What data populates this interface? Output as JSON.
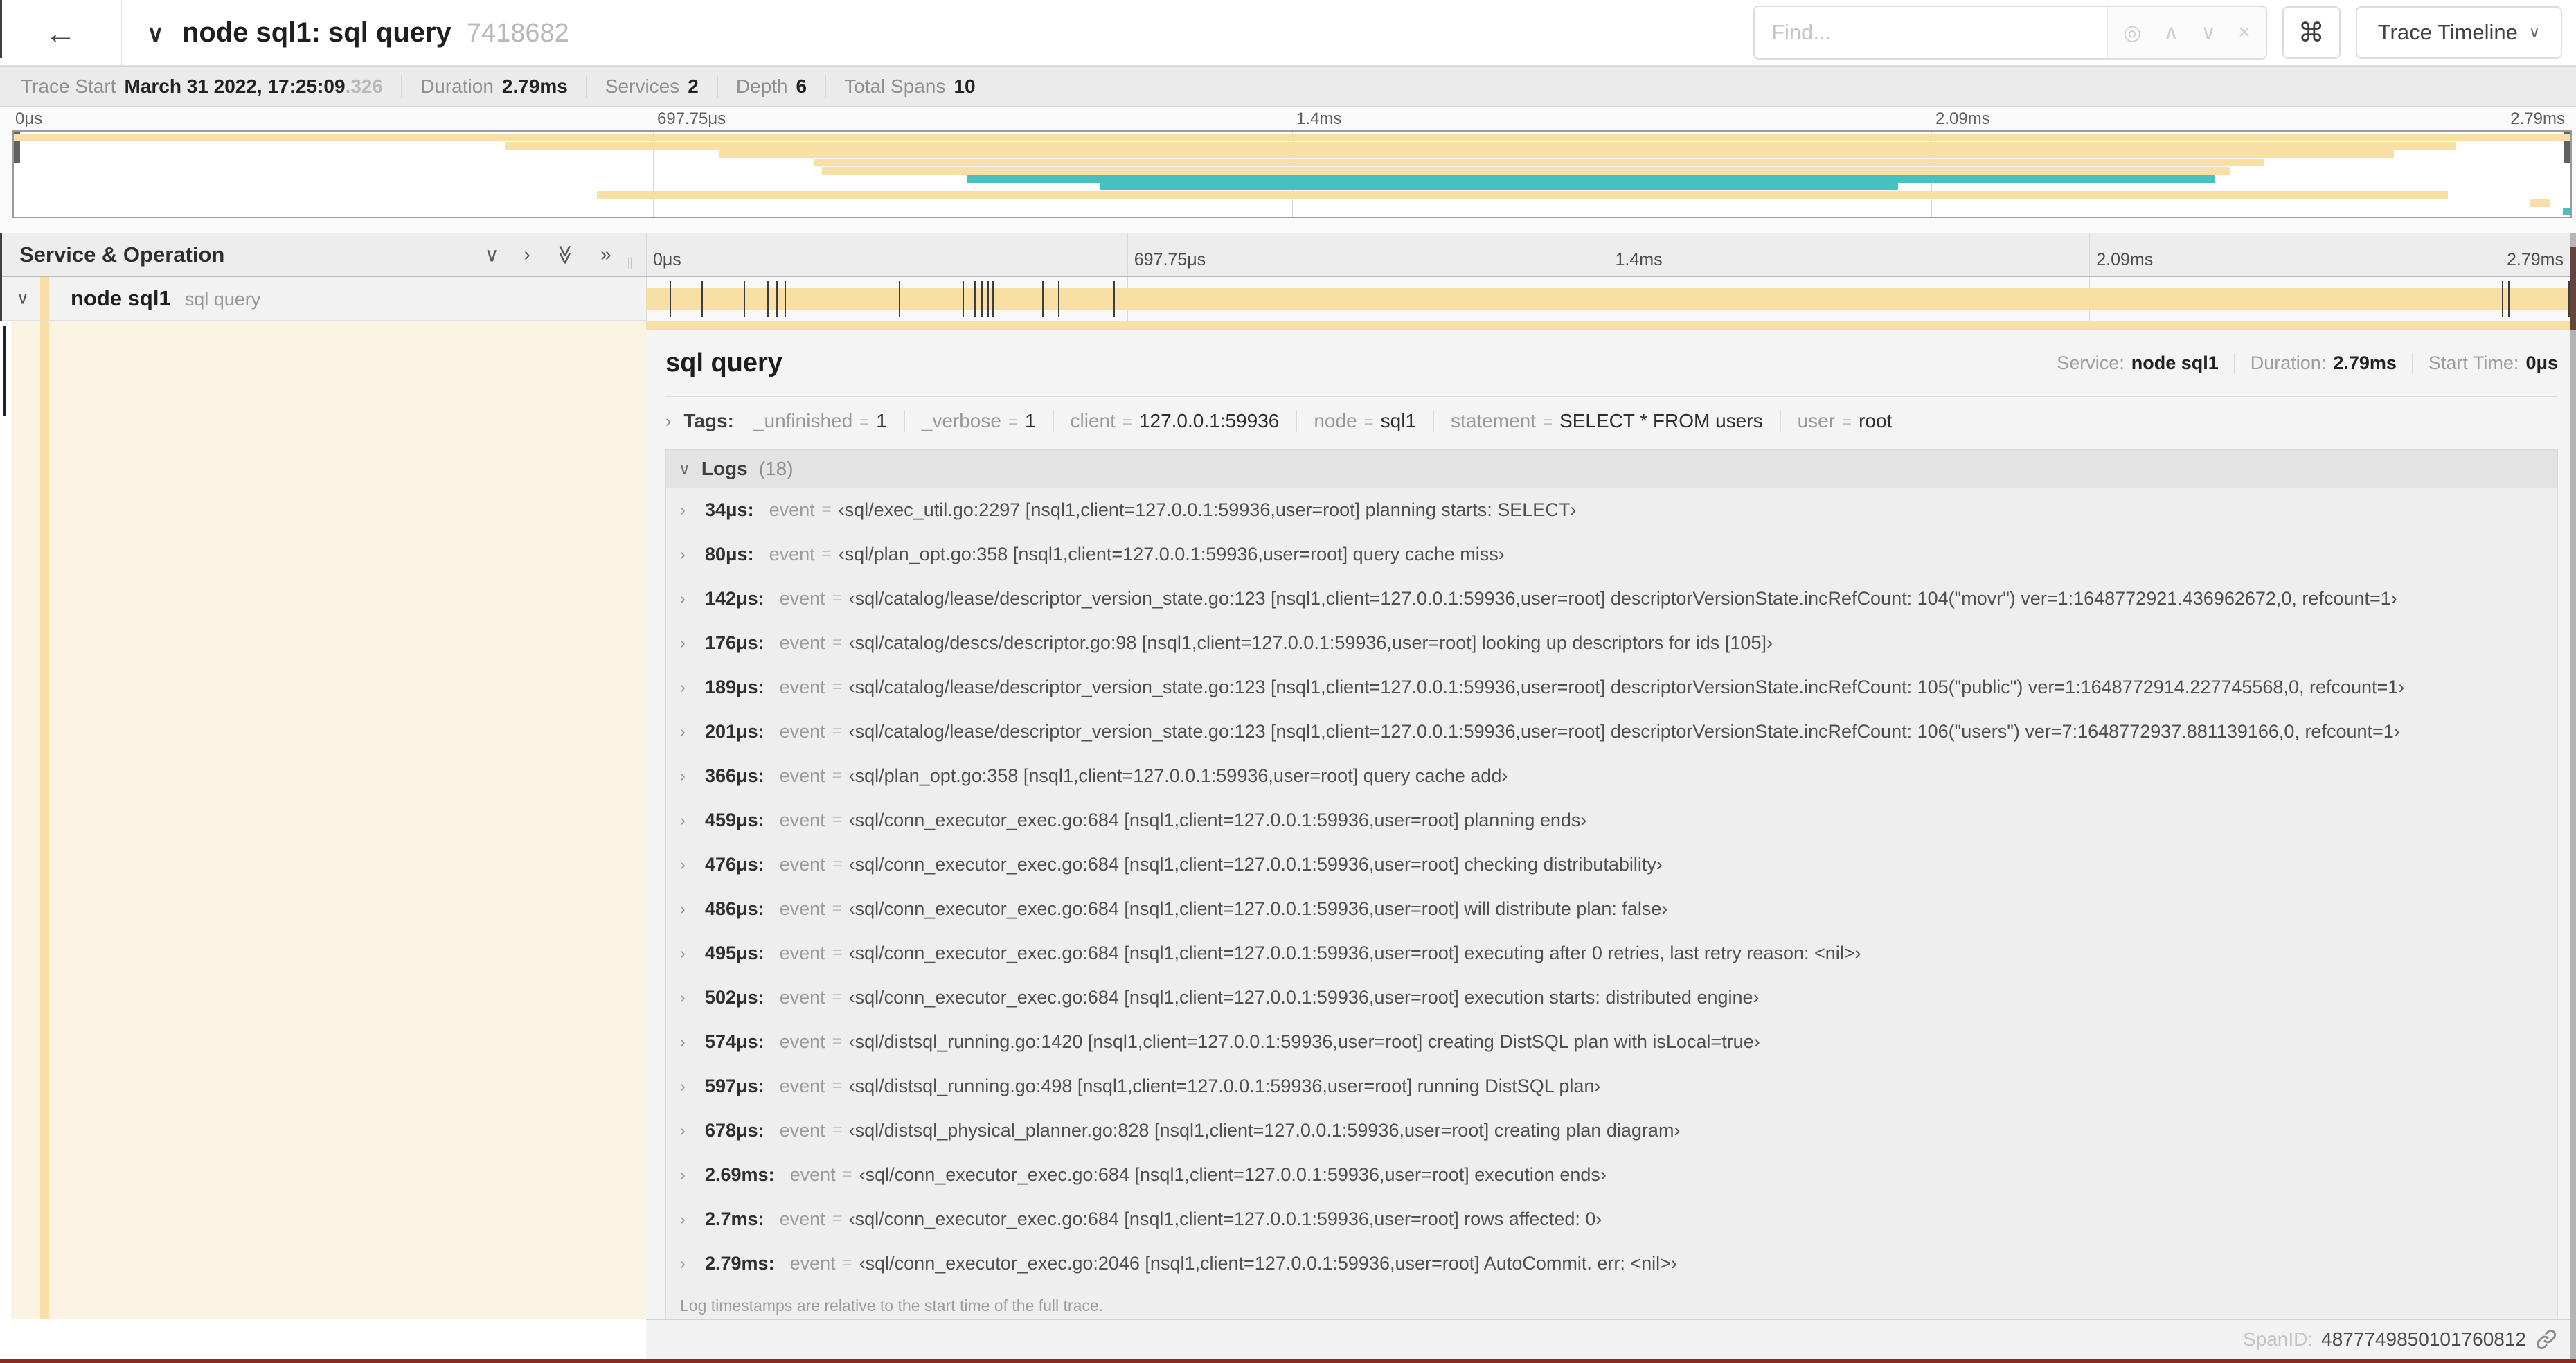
{
  "icons": {
    "back": "←",
    "chevron_down": "∨",
    "chevron_up": "∧",
    "chevron_right": "›",
    "double_down": "≫",
    "double_right": "»",
    "locate": "◎",
    "close": "×",
    "command": "⌘",
    "caret_down": "∨",
    "resizer": "‖"
  },
  "colors": {
    "span_tan": "#f7dfa6",
    "span_teal": "#45c1c1",
    "bottom_accent": "#8a2c21"
  },
  "topbar": {
    "title": "node sql1: sql query",
    "trace_id": "7418682",
    "find": {
      "placeholder": "Find..."
    },
    "view_button": {
      "label": "Trace Timeline"
    }
  },
  "trace_meta": {
    "items": [
      {
        "label": "Trace Start",
        "value": "March 31 2022, 17:25:09",
        "suffix": ".326"
      },
      {
        "label": "Duration",
        "value": "2.79ms"
      },
      {
        "label": "Services",
        "value": "2"
      },
      {
        "label": "Depth",
        "value": "6"
      },
      {
        "label": "Total Spans",
        "value": "10"
      }
    ]
  },
  "minimap": {
    "labels": [
      {
        "text": "0μs",
        "pos": 0
      },
      {
        "text": "697.75μs",
        "pos": 25
      },
      {
        "text": "1.4ms",
        "pos": 50
      },
      {
        "text": "2.09ms",
        "pos": 75
      },
      {
        "text": "2.79ms",
        "pos": 100
      }
    ],
    "spans": [
      {
        "row": 0,
        "start": 0,
        "end": 100,
        "color": "tan"
      },
      {
        "row": 1,
        "start": 19.2,
        "end": 95.5,
        "color": "tan"
      },
      {
        "row": 2,
        "start": 27.6,
        "end": 93.1,
        "color": "tan"
      },
      {
        "row": 3,
        "start": 31.3,
        "end": 88.0,
        "color": "tan"
      },
      {
        "row": 4,
        "start": 31.6,
        "end": 86.7,
        "color": "tan"
      },
      {
        "row": 5,
        "start": 37.3,
        "end": 86.1,
        "color": "teal"
      },
      {
        "row": 6,
        "start": 42.5,
        "end": 73.7,
        "color": "teal"
      },
      {
        "row": 7,
        "start": 22.8,
        "end": 95.2,
        "color": "tan"
      },
      {
        "row": 8,
        "start": 98.4,
        "end": 99.2,
        "color": "tan"
      },
      {
        "row": 9,
        "start": 99.7,
        "end": 100,
        "color": "teal"
      }
    ]
  },
  "timeline_header": {
    "left_title": "Service & Operation",
    "ticks": [
      {
        "text": "0μs",
        "pos": 0
      },
      {
        "text": "697.75μs",
        "pos": 25
      },
      {
        "text": "1.4ms",
        "pos": 50
      },
      {
        "text": "2.09ms",
        "pos": 75
      },
      {
        "text": "2.79ms",
        "pos": 100
      }
    ]
  },
  "span_row": {
    "service": "node sql1",
    "operation": "sql query",
    "tick_positions": [
      1.22,
      2.87,
      5.09,
      6.31,
      6.77,
      7.2,
      13.12,
      16.45,
      17.06,
      17.42,
      17.74,
      17.99,
      20.57,
      21.4,
      24.3,
      96.42,
      96.77,
      99.9
    ]
  },
  "detail": {
    "title": "sql query",
    "stats": [
      {
        "label": "Service:",
        "value": "node sql1"
      },
      {
        "label": "Duration:",
        "value": "2.79ms"
      },
      {
        "label": "Start Time:",
        "value": "0μs"
      }
    ],
    "tags_label": "Tags:",
    "kv_separator": "=",
    "tags": [
      {
        "key": "_unfinished",
        "value": "1"
      },
      {
        "key": "_verbose",
        "value": "1"
      },
      {
        "key": "client",
        "value": "127.0.0.1:59936"
      },
      {
        "key": "node",
        "value": "sql1"
      },
      {
        "key": "statement",
        "value": "SELECT * FROM users"
      },
      {
        "key": "user",
        "value": "root"
      }
    ],
    "logs_label": "Logs",
    "logs_count": "(18)",
    "log_key": "event",
    "logs": [
      {
        "time": "34μs:",
        "value": "‹sql/exec_util.go:2297 [nsql1,client=127.0.0.1:59936,user=root] planning starts: SELECT›"
      },
      {
        "time": "80μs:",
        "value": "‹sql/plan_opt.go:358 [nsql1,client=127.0.0.1:59936,user=root] query cache miss›"
      },
      {
        "time": "142μs:",
        "value": "‹sql/catalog/lease/descriptor_version_state.go:123 [nsql1,client=127.0.0.1:59936,user=root] descriptorVersionState.incRefCount: 104(\"movr\") ver=1:1648772921.436962672,0, refcount=1›"
      },
      {
        "time": "176μs:",
        "value": "‹sql/catalog/descs/descriptor.go:98 [nsql1,client=127.0.0.1:59936,user=root] looking up descriptors for ids [105]›"
      },
      {
        "time": "189μs:",
        "value": "‹sql/catalog/lease/descriptor_version_state.go:123 [nsql1,client=127.0.0.1:59936,user=root] descriptorVersionState.incRefCount: 105(\"public\") ver=1:1648772914.227745568,0, refcount=1›"
      },
      {
        "time": "201μs:",
        "value": "‹sql/catalog/lease/descriptor_version_state.go:123 [nsql1,client=127.0.0.1:59936,user=root] descriptorVersionState.incRefCount: 106(\"users\") ver=7:1648772937.881139166,0, refcount=1›"
      },
      {
        "time": "366μs:",
        "value": "‹sql/plan_opt.go:358 [nsql1,client=127.0.0.1:59936,user=root] query cache add›"
      },
      {
        "time": "459μs:",
        "value": "‹sql/conn_executor_exec.go:684 [nsql1,client=127.0.0.1:59936,user=root] planning ends›"
      },
      {
        "time": "476μs:",
        "value": "‹sql/conn_executor_exec.go:684 [nsql1,client=127.0.0.1:59936,user=root] checking distributability›"
      },
      {
        "time": "486μs:",
        "value": "‹sql/conn_executor_exec.go:684 [nsql1,client=127.0.0.1:59936,user=root] will distribute plan: false›"
      },
      {
        "time": "495μs:",
        "value": "‹sql/conn_executor_exec.go:684 [nsql1,client=127.0.0.1:59936,user=root] executing after 0 retries, last retry reason: <nil>›"
      },
      {
        "time": "502μs:",
        "value": "‹sql/conn_executor_exec.go:684 [nsql1,client=127.0.0.1:59936,user=root] execution starts: distributed engine›"
      },
      {
        "time": "574μs:",
        "value": "‹sql/distsql_running.go:1420 [nsql1,client=127.0.0.1:59936,user=root] creating DistSQL plan with isLocal=true›"
      },
      {
        "time": "597μs:",
        "value": "‹sql/distsql_running.go:498 [nsql1,client=127.0.0.1:59936,user=root] running DistSQL plan›"
      },
      {
        "time": "678μs:",
        "value": "‹sql/distsql_physical_planner.go:828 [nsql1,client=127.0.0.1:59936,user=root] creating plan diagram›"
      },
      {
        "time": "2.69ms:",
        "value": "‹sql/conn_executor_exec.go:684 [nsql1,client=127.0.0.1:59936,user=root] execution ends›"
      },
      {
        "time": "2.7ms:",
        "value": "‹sql/conn_executor_exec.go:684 [nsql1,client=127.0.0.1:59936,user=root] rows affected: 0›"
      },
      {
        "time": "2.79ms:",
        "value": "‹sql/conn_executor_exec.go:2046 [nsql1,client=127.0.0.1:59936,user=root] AutoCommit. err: <nil>›"
      }
    ],
    "footer_note": "Log timestamps are relative to the start time of the full trace.",
    "span_id_label": "SpanID:",
    "span_id": "4877749850101760812"
  }
}
